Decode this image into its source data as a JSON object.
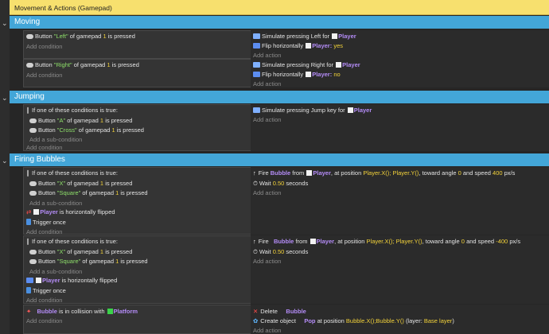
{
  "comment": "Movement & Actions (Gamepad)",
  "groups": {
    "moving": "Moving",
    "jumping": "Jumping",
    "firing": "Firing Bubbles"
  },
  "common": {
    "add_condition": "Add condition",
    "add_action": "Add action",
    "add_sub_condition": "Add a sub-condition",
    "if_one": "If one of these conditions is true:",
    "trigger_once": "Trigger once",
    "button": "Button",
    "of_gamepad": "of gamepad",
    "is_pressed": "is pressed",
    "gamepad_num": "1",
    "player": "Player",
    "bubble": "Bubble",
    "is_h_flipped": "is horizontally flipped",
    "flip_h": "Flip horizontally",
    "colon": ":",
    "fire": "Fire",
    "from": "from",
    "at_position": ", at position",
    "toward_angle": ", toward angle",
    "and_speed": "and speed",
    "pxs": "px/s",
    "wait": "Wait",
    "seconds": "seconds",
    "angle": "0",
    "wait_val": "0.50"
  },
  "moving": {
    "e1": {
      "btn": "\"Left\"",
      "act": "Simulate pressing Left for",
      "flip": "yes"
    },
    "e2": {
      "btn": "\"Right\"",
      "act": "Simulate pressing Right for",
      "flip": "no"
    }
  },
  "jumping": {
    "btn_a": "\"A\"",
    "btn_cross": "\"Cross\"",
    "act": "Simulate pressing Jump key for"
  },
  "firing": {
    "btn_x": "\"X\"",
    "btn_square": "\"Square\"",
    "x_expr": "Player.X();",
    "y_expr": "Player.Y()",
    "speed1": "400",
    "speed2": "-400"
  },
  "collision": {
    "is_in_collision": "is in collision with",
    "platform": "Platform",
    "delete": "Delete",
    "create_object": "Create object",
    "pop": "Pop",
    "at_position": "at position",
    "pos_expr": "Bubble.X();Bubble.Y()",
    "layer_label": "(layer:",
    "layer_val": "Base layer",
    "layer_close": ")"
  }
}
